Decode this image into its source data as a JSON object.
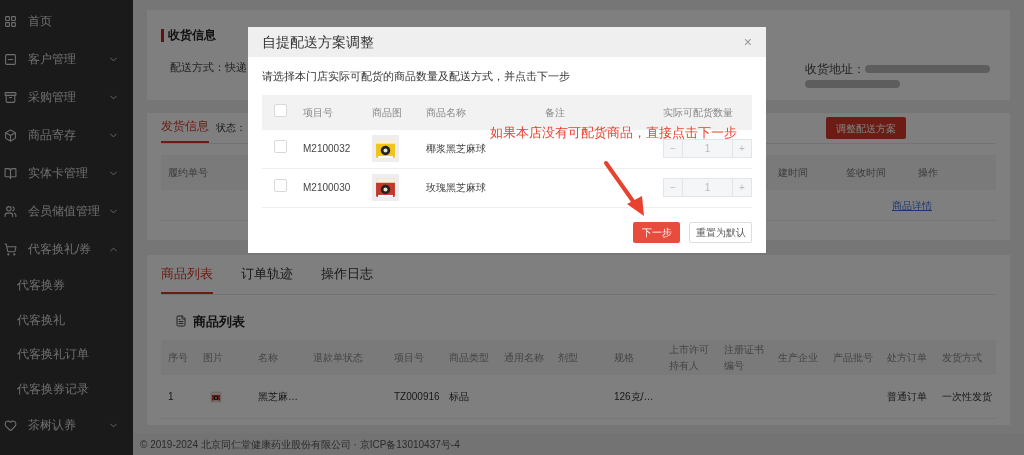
{
  "sidebar": {
    "items": [
      {
        "label": "首页"
      },
      {
        "label": "客户管理",
        "expanded": false
      },
      {
        "label": "采购管理",
        "expanded": false
      },
      {
        "label": "商品寄存",
        "expanded": false
      },
      {
        "label": "实体卡管理",
        "expanded": false
      },
      {
        "label": "会员储值管理",
        "expanded": false
      },
      {
        "label": "代客换礼/券",
        "expanded": true,
        "children": [
          {
            "label": "代客换券"
          },
          {
            "label": "代客换礼"
          },
          {
            "label": "代客换礼订单"
          },
          {
            "label": "代客换券记录"
          }
        ]
      },
      {
        "label": "茶树认养",
        "expanded": false
      }
    ]
  },
  "receiving": {
    "title": "收货信息",
    "delivery": "配送方式：快递",
    "address_label": "收货地址："
  },
  "shipping": {
    "tabs": [
      {
        "label": "发货信息",
        "selected": true
      }
    ],
    "status_label": "状态：",
    "adjust_button": "调整配送方案",
    "columns": [
      "履约单号",
      "建时间",
      "签收时间",
      "操作"
    ],
    "detail_link": "商品详情"
  },
  "products": {
    "tabs": [
      {
        "label": "商品列表",
        "selected": true
      },
      {
        "label": "订单轨迹",
        "selected": false
      },
      {
        "label": "操作日志",
        "selected": false
      }
    ],
    "heading": "商品列表",
    "columns": [
      "序号",
      "图片",
      "名称",
      "退款单状态",
      "项目号",
      "商品类型",
      "通用名称",
      "剂型",
      "规格",
      "上市许可持有人",
      "注册证书编号",
      "生产企业",
      "产品批号",
      "处方订单",
      "发货方式"
    ],
    "rows": [
      {
        "cells": [
          "1",
          {
            "kind": "picture"
          },
          "黑芝麻…",
          null,
          "TZ000916",
          "标品",
          null,
          null,
          "126克/…",
          null,
          null,
          null,
          null,
          "普通订单",
          "一次性发货"
        ]
      }
    ]
  },
  "footer": "© 2019-2024 北京同仁堂健康药业股份有限公司 · 京ICP备13010437号-4",
  "dialog": {
    "title": "自提配送方案调整",
    "close": "×",
    "instruction": "请选择本门店实际可配货的商品数量及配送方式，并点击下一步",
    "select_all": {
      "checked": false
    },
    "columns": [
      "项目号",
      "商品图",
      "商品名称",
      "备注",
      "实际可配货数量"
    ],
    "rows": [
      {
        "checked": false,
        "item_no": "M2100032",
        "name": "椰浆黑芝麻球",
        "quantity": "1",
        "minus": "−",
        "plus": "+"
      },
      {
        "checked": false,
        "item_no": "M2100030",
        "name": "玫瑰黑芝麻球",
        "quantity": "1",
        "minus": "−",
        "plus": "+"
      }
    ],
    "next_button": "下一步",
    "reset_button": "重置为默认"
  },
  "annotation": {
    "text": "如果本店没有可配货商品，直接点击下一步"
  }
}
